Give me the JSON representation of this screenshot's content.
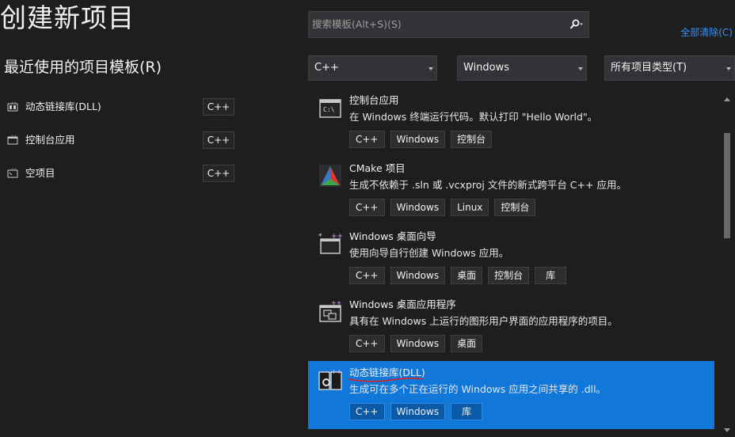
{
  "header": {
    "title": "创建新项目",
    "recent_title": "最近使用的项目模板(R)"
  },
  "search": {
    "placeholder": "搜索模板(Alt+S)(S)",
    "icon": "search-icon"
  },
  "clear_all_label": "全部清除(C)",
  "filters": {
    "language": "C++",
    "platform": "Windows",
    "project_type": "所有项目类型(T)"
  },
  "recent": {
    "items": [
      {
        "label": "动态链接库(DLL)",
        "tag": "C++",
        "icon": "dll-icon"
      },
      {
        "label": "控制台应用",
        "tag": "C++",
        "icon": "console-icon"
      },
      {
        "label": "空项目",
        "tag": "C++",
        "icon": "empty-project-icon"
      }
    ]
  },
  "templates": {
    "items": [
      {
        "title": "控制台应用",
        "desc": "在 Windows 终端运行代码。默认打印 \"Hello World\"。",
        "tags": [
          "C++",
          "Windows",
          "控制台"
        ],
        "icon": "console-app-icon"
      },
      {
        "title": "CMake 项目",
        "desc": "生成不依赖于 .sln 或 .vcxproj 文件的新式跨平台 C++ 应用。",
        "tags": [
          "C++",
          "Windows",
          "Linux",
          "控制台"
        ],
        "icon": "cmake-icon"
      },
      {
        "title": "Windows 桌面向导",
        "desc": "使用向导自行创建 Windows 应用。",
        "tags": [
          "C++",
          "Windows",
          "桌面",
          "控制台",
          "库"
        ],
        "icon": "wizard-icon"
      },
      {
        "title": "Windows 桌面应用程序",
        "desc": "具有在 Windows 上运行的图形用户界面的应用程序的项目。",
        "tags": [
          "C++",
          "Windows",
          "桌面"
        ],
        "icon": "desktop-app-icon"
      },
      {
        "title": "动态链接库(DLL)",
        "desc": "生成可在多个正在运行的 Windows 应用之间共享的 .dll。",
        "tags": [
          "C++",
          "Windows",
          "库"
        ],
        "icon": "dll-template-icon",
        "selected": true
      }
    ]
  },
  "colors": {
    "background": "#1e1e1e",
    "selection": "#1177d8",
    "link": "#3794ff",
    "annotation": "#e0201a"
  }
}
